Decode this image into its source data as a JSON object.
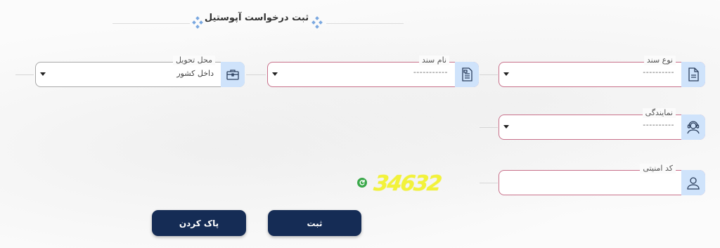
{
  "header": {
    "title": "ثبت درخواست آپوستیل"
  },
  "fields": {
    "delivery_place": {
      "label": "محل تحویل",
      "value": "داخل کشور",
      "icon": "briefcase-icon"
    },
    "doc_name": {
      "label": "نام سند",
      "value": "-----------",
      "icon": "document-icon"
    },
    "doc_type": {
      "label": "نوع سند",
      "value": "----------",
      "icon": "file-icon"
    },
    "agency": {
      "label": "نمایندگی",
      "value": "----------",
      "icon": "headset-agent-icon"
    },
    "security_code": {
      "label": "کد امنیتی",
      "value": "",
      "icon": "user-icon"
    }
  },
  "captcha": {
    "text": "34632"
  },
  "buttons": {
    "submit": "ثبت",
    "clear": "پاک کردن"
  },
  "colors": {
    "border_accent": "#c8708a",
    "icon_bg": "#cfe3fb",
    "button_bg": "#152c55",
    "captcha": "#f2f23a"
  }
}
